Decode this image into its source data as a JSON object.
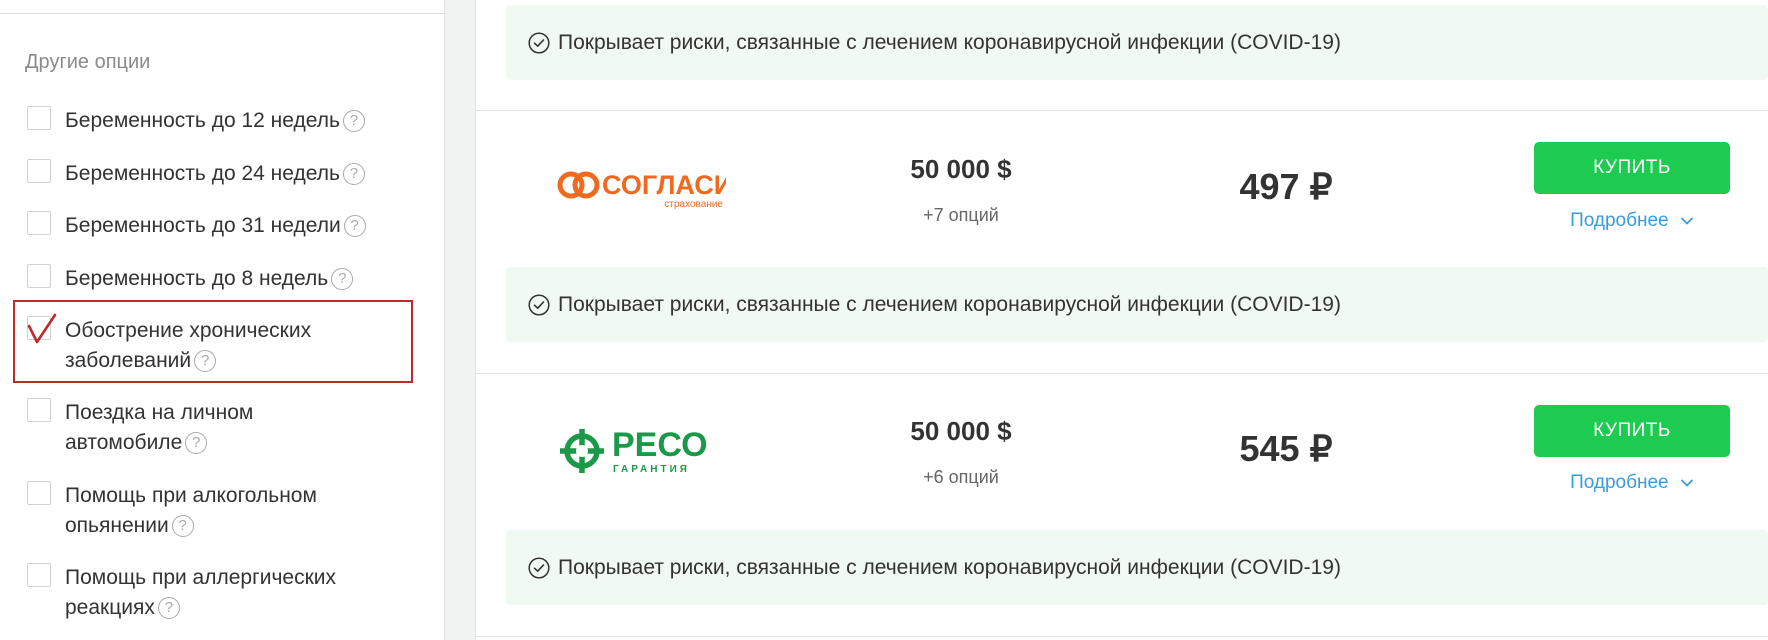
{
  "filters": {
    "section_title": "Другие опции",
    "options": [
      {
        "label": "Беременность до 12 недель",
        "checked": false
      },
      {
        "label": "Беременность до 24 недель",
        "checked": false
      },
      {
        "label": "Беременность до 31 недели",
        "checked": false
      },
      {
        "label": "Беременность до 8 недель",
        "checked": false
      },
      {
        "label_line1": "Обострение хронических",
        "label_line2": "заболеваний",
        "checked": true
      },
      {
        "label_line1": "Поездка на личном",
        "label_line2": "автомобиле",
        "checked": false
      },
      {
        "label_line1": "Помощь при алкогольном",
        "label_line2": "опьянении",
        "checked": false
      },
      {
        "label_line1": "Помощь при аллергических",
        "label_line2": "реакциях",
        "checked": false
      }
    ],
    "help_glyph": "?"
  },
  "results": {
    "covid_note": "Покрывает риски, связанные с лечением коронавирусной инфекции (COVID-19)",
    "offers": [
      {
        "insurer_logo": {
          "name": "СОГЛАСИЕ",
          "tagline": "страхование"
        },
        "coverage": "50 000 $",
        "options": "+7 опций",
        "price": "497 ₽",
        "buy_label": "КУПИТЬ",
        "details_label": "Подробнее"
      },
      {
        "insurer_logo": {
          "name": "РЕСО",
          "tagline": "ГАРАНТИЯ"
        },
        "coverage": "50 000 $",
        "options": "+6 опций",
        "price": "545 ₽",
        "buy_label": "КУПИТЬ",
        "details_label": "Подробнее"
      }
    ]
  },
  "colors": {
    "accent_green": "#1ccb4f",
    "link_blue": "#3b9bdc",
    "covid_bg": "#f0f9f2",
    "highlight_red": "#c02a2a",
    "soglasie_orange": "#ef6a1f",
    "reso_green": "#1a9a48"
  },
  "icons": {
    "covid_check": "check-circle-icon",
    "help": "question-circle-icon",
    "details": "chevron-down-icon",
    "checked_mark": "red-checkmark-icon"
  }
}
